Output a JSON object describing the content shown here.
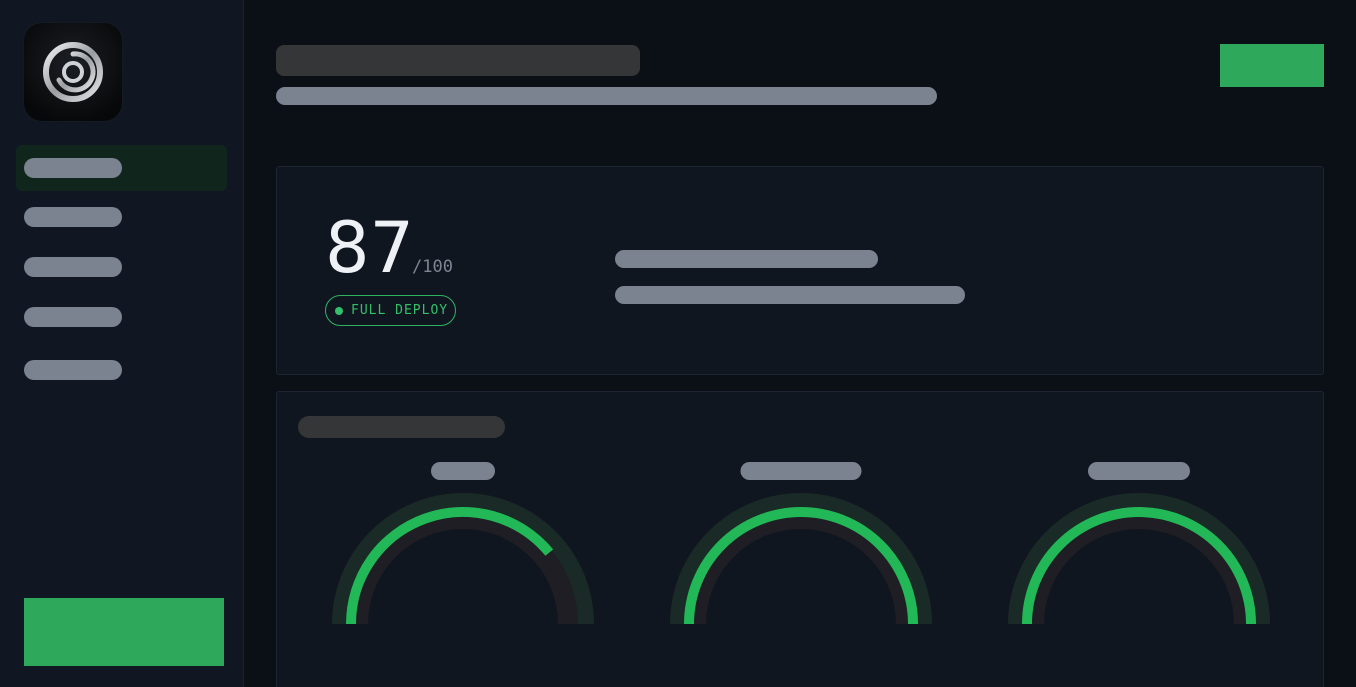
{
  "app": {
    "logo_icon": "swirl-logo-icon"
  },
  "sidebar": {
    "items": [
      {
        "icon": "nav-item-placeholder",
        "active": true
      },
      {
        "icon": "nav-item-placeholder",
        "active": false
      },
      {
        "icon": "nav-item-placeholder",
        "active": false
      },
      {
        "icon": "nav-item-placeholder",
        "active": false
      },
      {
        "icon": "nav-item-placeholder",
        "active": false
      }
    ]
  },
  "score": {
    "value": "87",
    "max": "/100",
    "status": "FULL DEPLOY",
    "status_color": "#34c06a"
  },
  "gauges": [
    {
      "level": 0.78
    },
    {
      "level": 1.0
    },
    {
      "level": 1.0
    }
  ],
  "colors": {
    "accent": "#2ea85a",
    "gauge_fill": "#22b857",
    "background": "#0b0f16"
  }
}
